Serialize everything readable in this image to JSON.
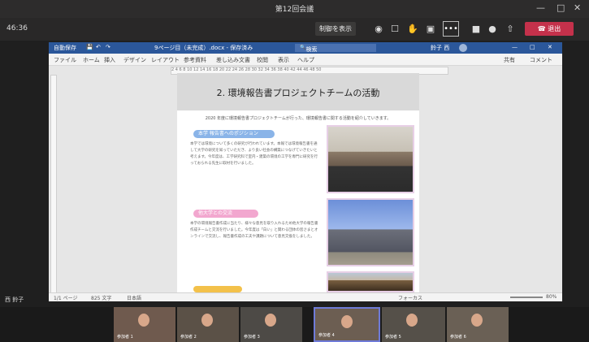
{
  "window": {
    "title": "第12回会議"
  },
  "meeting": {
    "timer": "46:36",
    "notes_button": "制御を表示",
    "more_button": "•••",
    "leave_button": "退出",
    "self_label": "西 鈴子"
  },
  "word": {
    "title": "9ページ目（未完成）.docx - 保存済み",
    "autosave": "自動保存",
    "search_placeholder": "検索",
    "user": "鈴子 西",
    "menu": [
      "ファイル",
      "ホーム",
      "挿入",
      "デザイン",
      "レイアウト",
      "参考資料",
      "差し込み文書",
      "校閲",
      "表示",
      "ヘルプ"
    ],
    "share": "共有",
    "comment": "コメント",
    "status": {
      "page": "1/1 ページ",
      "words": "825 文字",
      "lang": "日本語",
      "focus": "フォーカス",
      "zoom": "80%"
    }
  },
  "document": {
    "heading": "2. 環境報告書プロジェクトチームの活動",
    "intro": "2020 年度に環境報告書プロジェクトチームが行った、環境報告書に関する活動を紹介していきます。",
    "section1_title": "本学 報告書へのポジション",
    "section1_body": "本学では環境について多くの研究が行われています。本報では環境報告書を通して大学の研究を知っていただき、より良い社会の構築につなげていきたいと考えます。今年度は、工学研究科で室内・建築の環境の工学を専門に研究を行っておられる先生に取材を行いました。",
    "section2_title": "他大学との交流",
    "section2_body": "本学の環境報告書作成に当たり、様々な意見を取り入れるため他大学の報告書作成チームと交流を行いました。今年度は「白い」と関わる団体の皆さまとオンラインで交流し、報告書作成の工夫や課題について意見交換をしました。"
  },
  "participants": [
    "参加者 1",
    "参加者 2",
    "参加者 3",
    "参加者 4",
    "参加者 5",
    "参加者 6"
  ],
  "colors": {
    "word_blue": "#2b579a",
    "leave_red": "#c4314b",
    "teams_dark": "#292828"
  }
}
